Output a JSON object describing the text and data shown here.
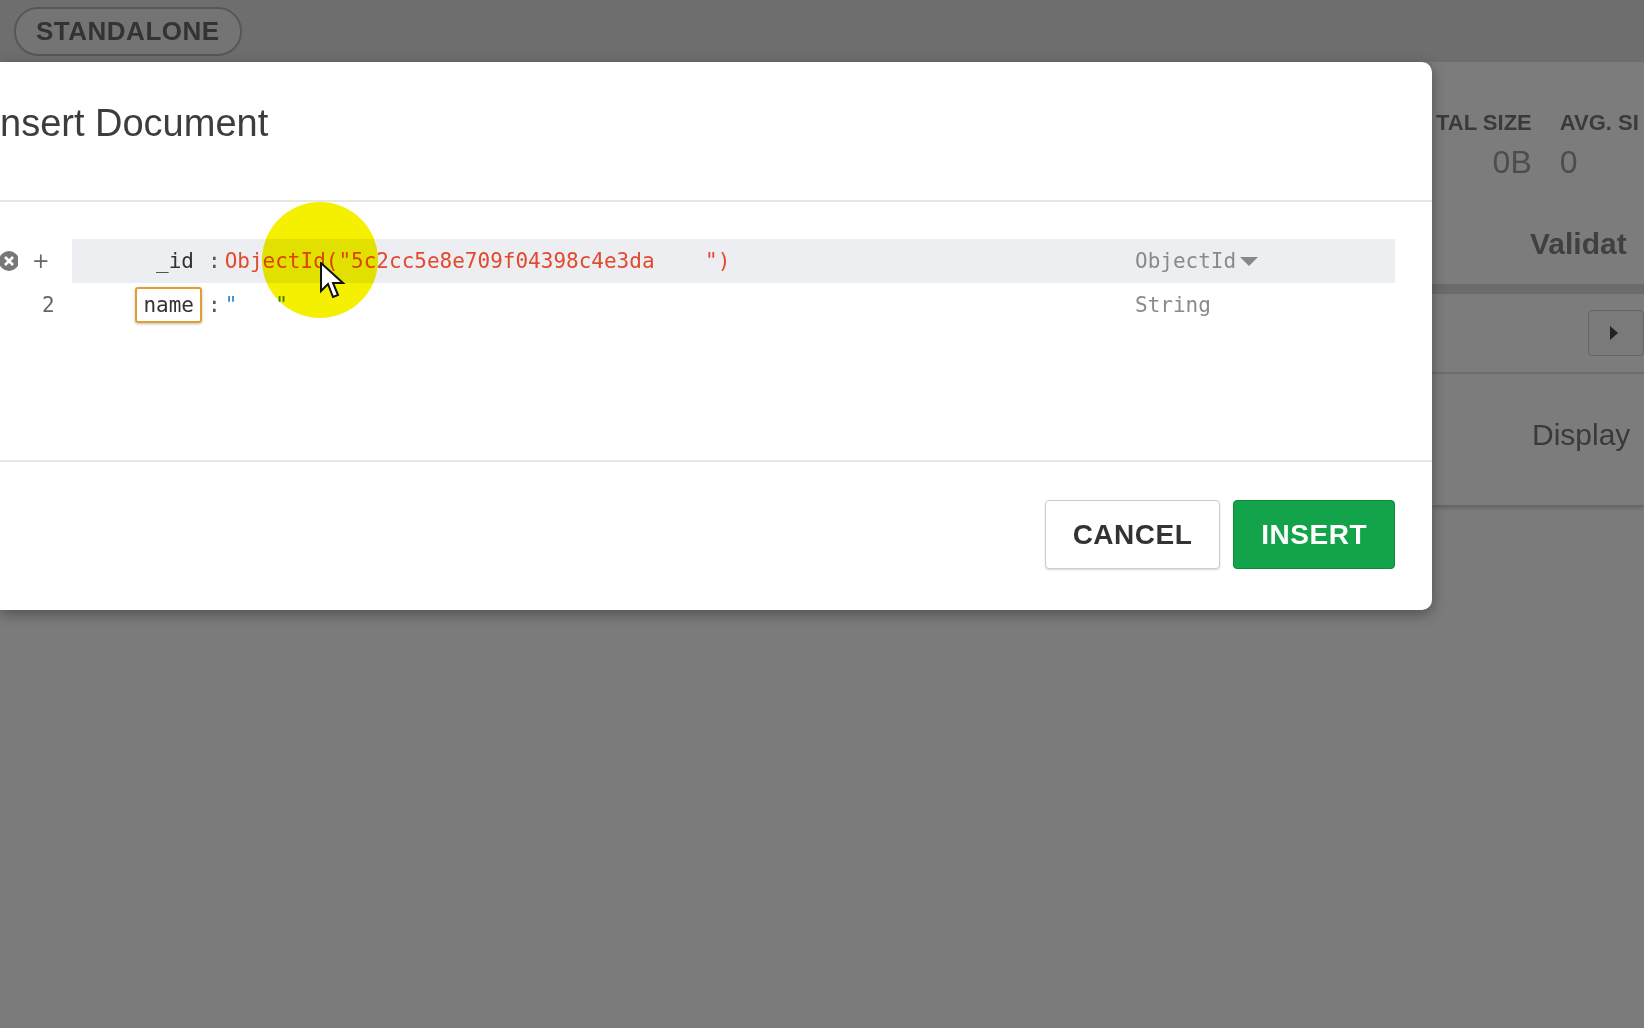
{
  "topbar": {
    "badge": "STANDALONE"
  },
  "dialog": {
    "title": "nsert Document",
    "rows": [
      {
        "kind": "field",
        "add_label": "+",
        "key": "_id",
        "separator": ":",
        "value": "ObjectId(\"5c2cc5e8e709f04398c4e3da    \")",
        "type": "ObjectId",
        "type_menu": true,
        "highlighted": true,
        "key_focused": false
      },
      {
        "kind": "line",
        "line_number": "2",
        "key": "name",
        "separator": ":",
        "value": "\"   \"",
        "type": "String",
        "type_menu": false,
        "highlighted": false,
        "key_focused": true
      }
    ],
    "buttons": [
      {
        "label": "CANCEL",
        "kind": "secondary"
      },
      {
        "label": "INSERT",
        "kind": "primary"
      }
    ]
  },
  "background": {
    "stats": [
      {
        "label": "TAL SIZE",
        "value": "0B"
      },
      {
        "label": "AVG. SI",
        "value": "0"
      }
    ],
    "section": "Validat",
    "section_2": "Display"
  }
}
